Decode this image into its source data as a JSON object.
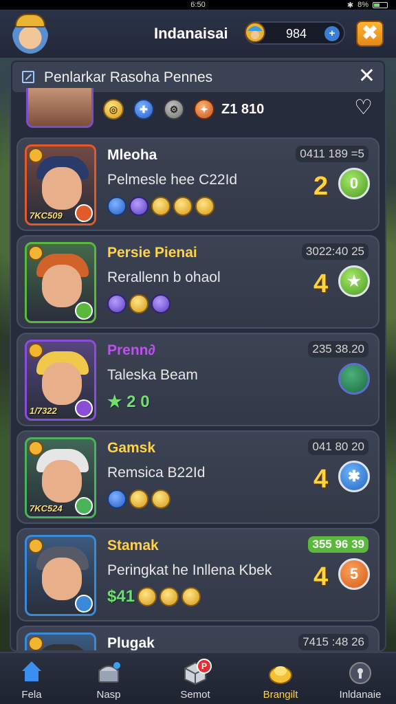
{
  "status_bar": {
    "time": "6:50",
    "battery": "8%"
  },
  "header": {
    "title": "Indanaisai",
    "currency_value": "984",
    "currency_plus": "+",
    "close_label": "✖"
  },
  "panel": {
    "title": "Penlarkar Rasoha Pennes",
    "close_label": "✕",
    "featured": {
      "icons": [
        "gold-coin-icon",
        "blue-token-icon",
        "gear-icon",
        "orange-token-icon"
      ],
      "value": "Z1 810"
    }
  },
  "cards": [
    {
      "name": "Mleoha",
      "name_color": "#ffffff",
      "subtitle": "Pelmesle hee C22Id",
      "level": "7KC509",
      "time": "0411 189 =5",
      "time_style": "dark",
      "rank": "2",
      "orb_label": "0",
      "orb_style": "green",
      "frame_color": "#e05a2a",
      "chips_numeric": "",
      "chips": [
        "blue",
        "purple",
        "gold",
        "gold",
        "gold"
      ]
    },
    {
      "name": "Persie Pienai",
      "name_color": "#ffd24a",
      "subtitle": "Rerallenn b ohaol",
      "level": "",
      "time": "3022:40 25",
      "time_style": "dark",
      "rank": "4",
      "orb_label": "★",
      "orb_style": "green",
      "frame_color": "#5ab83c",
      "chips_numeric": "",
      "chips": [
        "purple",
        "gold",
        "purple"
      ]
    },
    {
      "name": "Prenn∂",
      "name_color": "#c04ef0",
      "subtitle": "Taleska Beam",
      "level": "1/7322",
      "time": "235 38.20",
      "time_style": "dark",
      "rank": "",
      "orb_label": "",
      "orb_style": "dkgreen",
      "frame_color": "#8a4ed8",
      "chips_numeric": "★ 2 0",
      "chips": []
    },
    {
      "name": "Gamsk",
      "name_color": "#ffd24a",
      "subtitle": "Remsica B22Id",
      "level": "7KC524",
      "time": "041 80 20",
      "time_style": "dark",
      "rank": "4",
      "orb_label": "✱",
      "orb_style": "blue",
      "frame_color": "#4bb35a",
      "chips_numeric": "",
      "chips": [
        "blue",
        "gold",
        "gold"
      ]
    },
    {
      "name": "Stamak",
      "name_color": "#ffd24a",
      "subtitle": "Peringkat he Inllena Kbek",
      "level": "",
      "time": "355 96 39",
      "time_style": "green",
      "rank": "4",
      "orb_label": "5",
      "orb_style": "orange",
      "frame_color": "#3a8ad8",
      "chips_numeric": "$41",
      "chips": [
        "gold",
        "gold",
        "gold"
      ]
    },
    {
      "name": "Plugak",
      "name_color": "#ffffff",
      "subtitle": "",
      "level": "",
      "time": "7415 :48 26",
      "time_style": "dark",
      "rank": "",
      "orb_label": "",
      "orb_style": "",
      "frame_color": "#3a8ad8",
      "chips_numeric": "",
      "chips": []
    }
  ],
  "bottom_nav": [
    {
      "label": "Fela",
      "icon": "home-icon",
      "active": false
    },
    {
      "label": "Nasp",
      "icon": "chest-icon",
      "active": false
    },
    {
      "label": "Semot",
      "icon": "cube-icon",
      "active": false,
      "notification": "P"
    },
    {
      "label": "Brangilt",
      "icon": "gold-helmet-icon",
      "active": true
    },
    {
      "label": "Inldanaie",
      "icon": "lock-icon",
      "active": false
    }
  ]
}
